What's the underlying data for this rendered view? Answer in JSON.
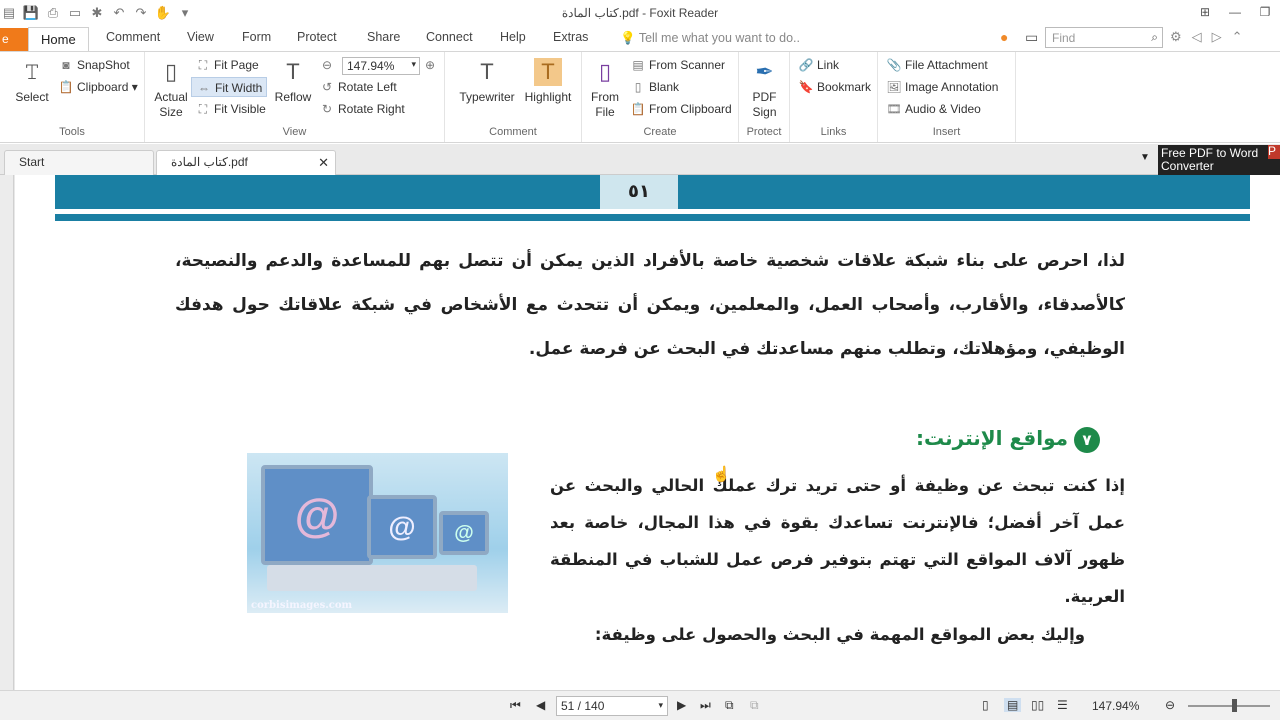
{
  "window": {
    "title": "كتاب المادة.pdf - Foxit Reader"
  },
  "ribbon_tabs": {
    "file": "e",
    "home": "Home",
    "items": [
      "Comment",
      "View",
      "Form",
      "Protect",
      "Share",
      "Connect",
      "Help",
      "Extras"
    ],
    "tell_me": "Tell me what you want to do..",
    "find_placeholder": "Find"
  },
  "ribbon": {
    "tools": {
      "select": "Select",
      "snapshot": "SnapShot",
      "clipboard": "Clipboard",
      "label": "Tools"
    },
    "view": {
      "actual_size": "Actual\nSize",
      "fit_page": "Fit Page",
      "fit_width": "Fit Width",
      "fit_visible": "Fit Visible",
      "reflow": "Reflow",
      "zoom": "147.94%",
      "rotate_left": "Rotate Left",
      "rotate_right": "Rotate Right",
      "label": "View"
    },
    "comment": {
      "typewriter": "Typewriter",
      "highlight": "Highlight",
      "label": "Comment"
    },
    "create": {
      "from_file": "From\nFile",
      "from_scanner": "From Scanner",
      "blank": "Blank",
      "from_clipboard": "From Clipboard",
      "label": "Create"
    },
    "protect": {
      "pdf_sign": "PDF\nSign",
      "label": "Protect"
    },
    "links": {
      "link": "Link",
      "bookmark": "Bookmark",
      "label": "Links"
    },
    "insert": {
      "file_attachment": "File Attachment",
      "image_annotation": "Image Annotation",
      "audio_video": "Audio & Video",
      "label": "Insert"
    }
  },
  "doc_tabs": {
    "start": "Start",
    "file": "كتاب المادة.pdf",
    "ad_line1": "Free PDF to Word",
    "ad_line2": "Converter",
    "ad_badge": "P"
  },
  "page": {
    "number": "٥١",
    "para1": "لذا، احرص على بناء شبكة علاقات شخصية خاصة بالأفراد الذين يمكن أن تتصل بهم للمساعدة والدعم والنصيحة، كالأصدقاء، والأقارب، وأصحاب العمل، والمعلمين، ويمكن أن تتحدث مع الأشخاص في شبكة علاقاتك حول هدفك الوظيفي، ومؤهلاتك، وتطلب منهم مساعدتك في البحث عن فرصة عمل.",
    "heading_num": "٧",
    "heading": "مواقع الإنترنت:",
    "para2": "إذا كنت تبحث عن وظيفة أو حتى تريد ترك عملك الحالي والبحث عن عمل آخر أفضل؛ فالإنترنت تساعدك بقوة في هذا المجال، خاصة بعد ظهور آلاف المواقع التي تهتم بتوفير فرص عمل للشباب في المنطقة العربية.",
    "para3": "وإليك بعض المواقع المهمة في البحث والحصول على وظيفة:",
    "photo_caption": "corbisimages.com"
  },
  "status": {
    "page_field": "51 / 140",
    "zoom": "147.94%"
  },
  "colors": {
    "band": "#1a7fa3",
    "heading": "#1e8a4a",
    "file_tab": "#f07a1a"
  }
}
